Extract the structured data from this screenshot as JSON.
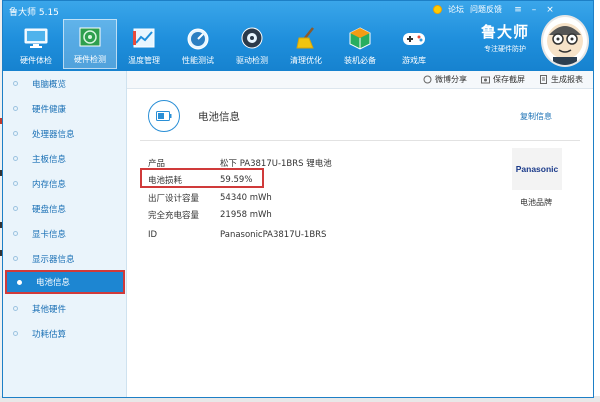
{
  "window": {
    "title": "鲁大师 5.15"
  },
  "top_links": {
    "forum": "论坛",
    "feedback": "问题反馈"
  },
  "nav": [
    {
      "label": "硬件体检",
      "icon": "monitor-icon"
    },
    {
      "label": "硬件检测",
      "icon": "chip-icon"
    },
    {
      "label": "温度管理",
      "icon": "thermometer-icon"
    },
    {
      "label": "性能测试",
      "icon": "speedometer-icon"
    },
    {
      "label": "驱动检测",
      "icon": "gear-icon"
    },
    {
      "label": "清理优化",
      "icon": "broom-icon"
    },
    {
      "label": "装机必备",
      "icon": "package-icon"
    },
    {
      "label": "游戏库",
      "icon": "gamepad-icon"
    }
  ],
  "brand": {
    "name": "鲁大师",
    "slogan": "专注硬件防护"
  },
  "sidebar": {
    "items": [
      {
        "label": "电脑概览"
      },
      {
        "label": "硬件健康"
      },
      {
        "label": "处理器信息"
      },
      {
        "label": "主板信息"
      },
      {
        "label": "内存信息"
      },
      {
        "label": "硬盘信息"
      },
      {
        "label": "显卡信息"
      },
      {
        "label": "显示器信息"
      },
      {
        "label": "电池信息"
      },
      {
        "label": "其他硬件"
      },
      {
        "label": "功耗估算"
      }
    ],
    "active_index": 8
  },
  "toolbar": {
    "share": "微博分享",
    "screenshot": "保存截屏",
    "report": "生成报表"
  },
  "section": {
    "title": "电池信息",
    "copy": "复制信息"
  },
  "info": [
    {
      "key": "产品",
      "value": "松下 PA3817U-1BRS 锂电池"
    },
    {
      "key": "电池损耗",
      "value": "59.59%"
    },
    {
      "key": "出厂设计容量",
      "value": "54340 mWh"
    },
    {
      "key": "完全充电容量",
      "value": "21958 mWh"
    },
    {
      "key": "ID",
      "value": "PanasonicPA3817U-1BRS"
    }
  ],
  "battery_brand": {
    "logo_text": "Panasonic",
    "caption": "电池品牌"
  },
  "colors": {
    "titlebar": "#1f8fdc",
    "accent": "#1d86d2",
    "highlight": "#d03a3a"
  }
}
